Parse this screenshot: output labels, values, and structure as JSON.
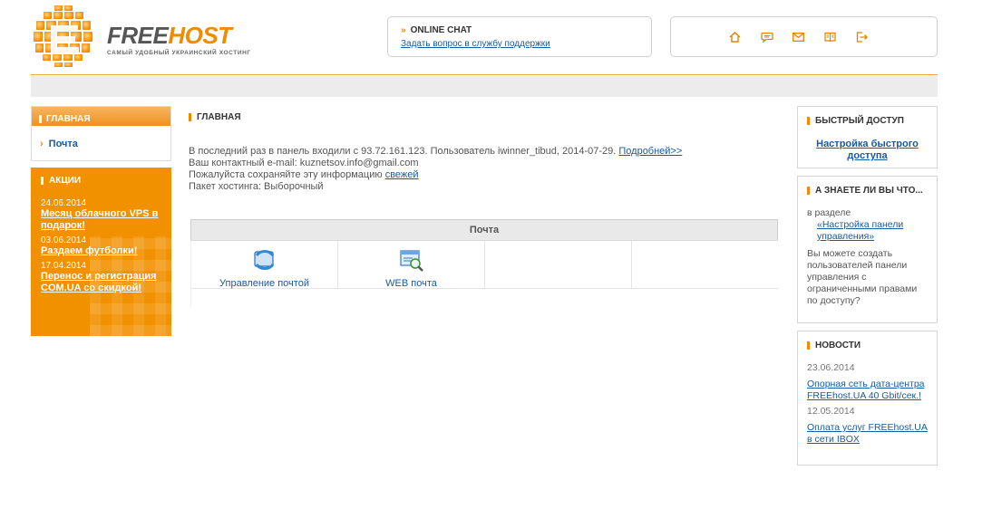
{
  "brand": {
    "name_part1": "FREE",
    "name_part2": "HOST",
    "slogan": "САМЫЙ УДОБНЫЙ УКРАИНСКИЙ ХОСТИНГ",
    "colors": {
      "orange": "#f08a00",
      "link": "#1a5aa0",
      "gray": "#555555"
    }
  },
  "chat": {
    "title": "ONLINE CHAT",
    "link": "Задать вопрос в службу поддержки"
  },
  "top_icons": [
    "home-icon",
    "chat-bubble-icon",
    "mail-icon",
    "book-icon",
    "logout-icon"
  ],
  "left_nav": {
    "header": "ГЛАВНАЯ",
    "items": [
      {
        "label": "Почта"
      }
    ]
  },
  "promo": {
    "title": "АКЦИИ",
    "items": [
      {
        "date": "24.06.2014",
        "title": "Месяц облачного VPS в подарок!"
      },
      {
        "date": "03.06.2014",
        "title": "Раздаем футболки!"
      },
      {
        "date": "17.04.2014",
        "title": "Перенос и регистрация COM.UA со скидкой!"
      }
    ]
  },
  "main": {
    "title": "ГЛАВНАЯ",
    "info_line1": "В последний раз в панель входили с 93.72.161.123. Пользователь iwinner_tibud, 2014-07-29.",
    "info_line1_link": "Подробней>>",
    "info_line2": "Ваш контактный e-mail: kuznetsov.info@gmail.com",
    "info_line3": "Пожалуйста сохраняйте эту информацию",
    "info_line3_link": "свежей",
    "info_line4": "Пакет хостинга: Выборочный",
    "mail_panel": {
      "header": "Почта",
      "items": [
        {
          "label": "Управление почтой",
          "icon": "mail-management-icon"
        },
        {
          "label": "WEB почта",
          "icon": "webmail-icon"
        }
      ]
    }
  },
  "right": {
    "quick": {
      "title": "БЫСТРЫЙ ДОСТУП",
      "link": "Настройка быстрого доступа"
    },
    "know": {
      "title": "А ЗНАЕТЕ ЛИ ВЫ ЧТО...",
      "prefix": "в разделе",
      "link": "«Настройка панели управления»",
      "body": "Вы можете создать пользователей панели управления с ограниченными правами по доступу?"
    },
    "news": {
      "title": "НОВОСТИ",
      "items": [
        {
          "date": "23.06.2014",
          "title": "Опорная сеть дата-центра FREEhost.UA 40 Gbit/сек.!"
        },
        {
          "date": "12.05.2014",
          "title": "Оплата услуг FREEhost.UA в сети IBOX"
        }
      ]
    }
  }
}
